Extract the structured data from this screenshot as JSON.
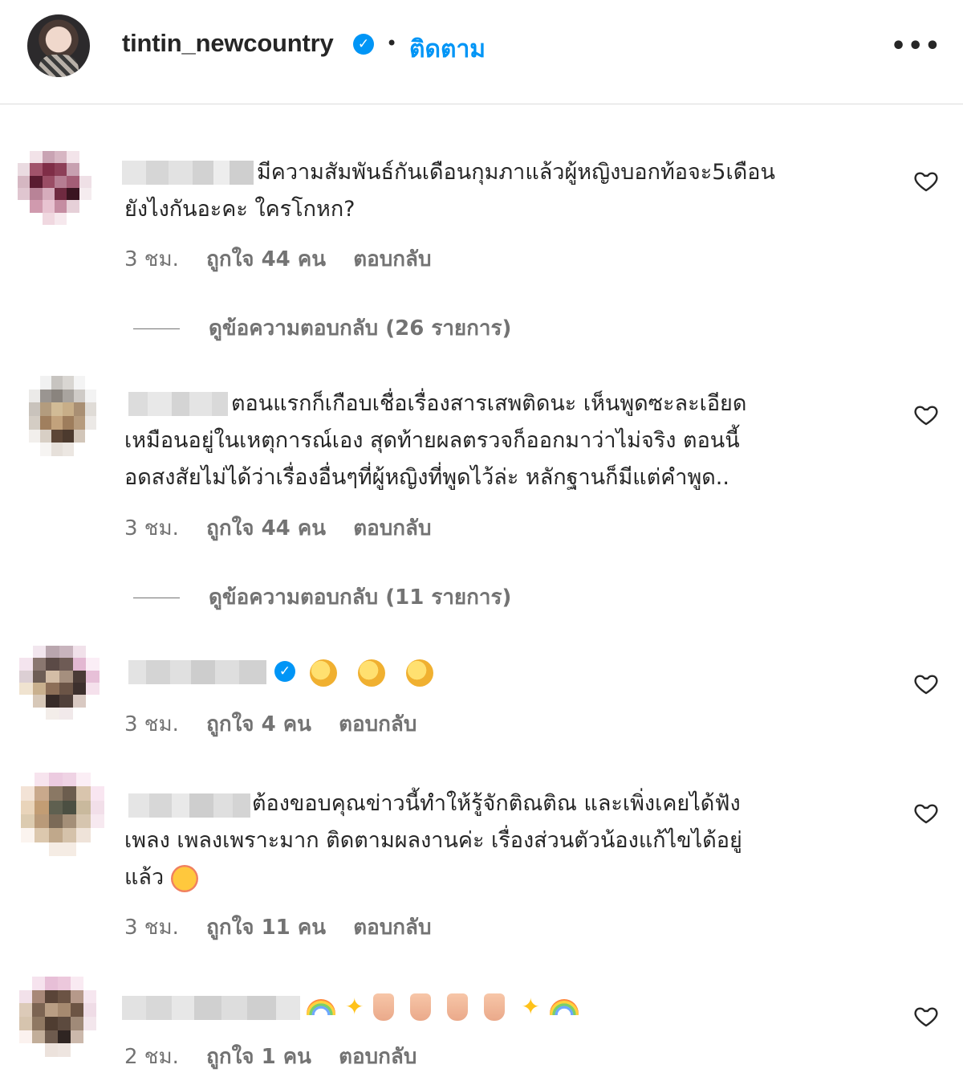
{
  "header": {
    "username": "tintin_newcountry",
    "verified_icon": "✓",
    "separator": "•",
    "follow_label": "ติดตาม",
    "more_label": "•••"
  },
  "comments": [
    {
      "lines": [
        "มีความสัมพันธ์กันเดือนกุมภาแล้วผู้หญิงบอกท้อจะ5เดือน",
        "ยังไงกันอะคะ ใครโกหก?"
      ],
      "time": "3 ชม.",
      "likes": "ถูกใจ 44 คน",
      "reply": "ตอบกลับ",
      "view_replies": "ดูข้อความตอบกลับ (26 รายการ)"
    },
    {
      "lines": [
        "ตอนแรกก็เกือบเชื่อเรื่องสารเสพติดนะ เห็นพูดซะละเอียด",
        "เหมือนอยู่ในเหตุการณ์เอง สุดท้ายผลตรวจก็ออกมาว่าไม่จริง ตอนนี้",
        "อดสงสัยไม่ได้ว่าเรื่องอื่นๆที่ผู้หญิงที่พูดไว้ล่ะ หลักฐานก็มีแต่คำพูด.."
      ],
      "time": "3 ชม.",
      "likes": "ถูกใจ 44 คน",
      "reply": "ตอบกลับ",
      "view_replies": "ดูข้อความตอบกลับ (11 รายการ)"
    },
    {
      "emojis": [
        "clapping-hands",
        "clapping-hands",
        "clapping-hands"
      ],
      "time": "3 ชม.",
      "likes": "ถูกใจ 4 คน",
      "reply": "ตอบกลับ"
    },
    {
      "lines": [
        "ต้องขอบคุณข่าวนี้ทำให้รู้จักติณติณ และเพิ่งเคยได้ฟัง",
        "เพลง เพลงเพราะมาก ติดตามผลงานค่ะ เรื่องส่วนตัวน้องแก้ไขได้อยู่",
        "แล้ว"
      ],
      "time": "3 ชม.",
      "likes": "ถูกใจ 11 คน",
      "reply": "ตอบกลับ"
    },
    {
      "emojis": [
        "rainbow",
        "sparkles",
        "victory-hand",
        "victory-hand",
        "victory-hand",
        "victory-hand",
        "sparkles",
        "rainbow"
      ],
      "time": "2 ชม.",
      "likes": "ถูกใจ 1 คน",
      "reply": "ตอบกลับ"
    }
  ],
  "colors": {
    "accent": "#0095f6",
    "text": "#262626",
    "secondary": "#737373",
    "divider": "#dbdbdb"
  }
}
